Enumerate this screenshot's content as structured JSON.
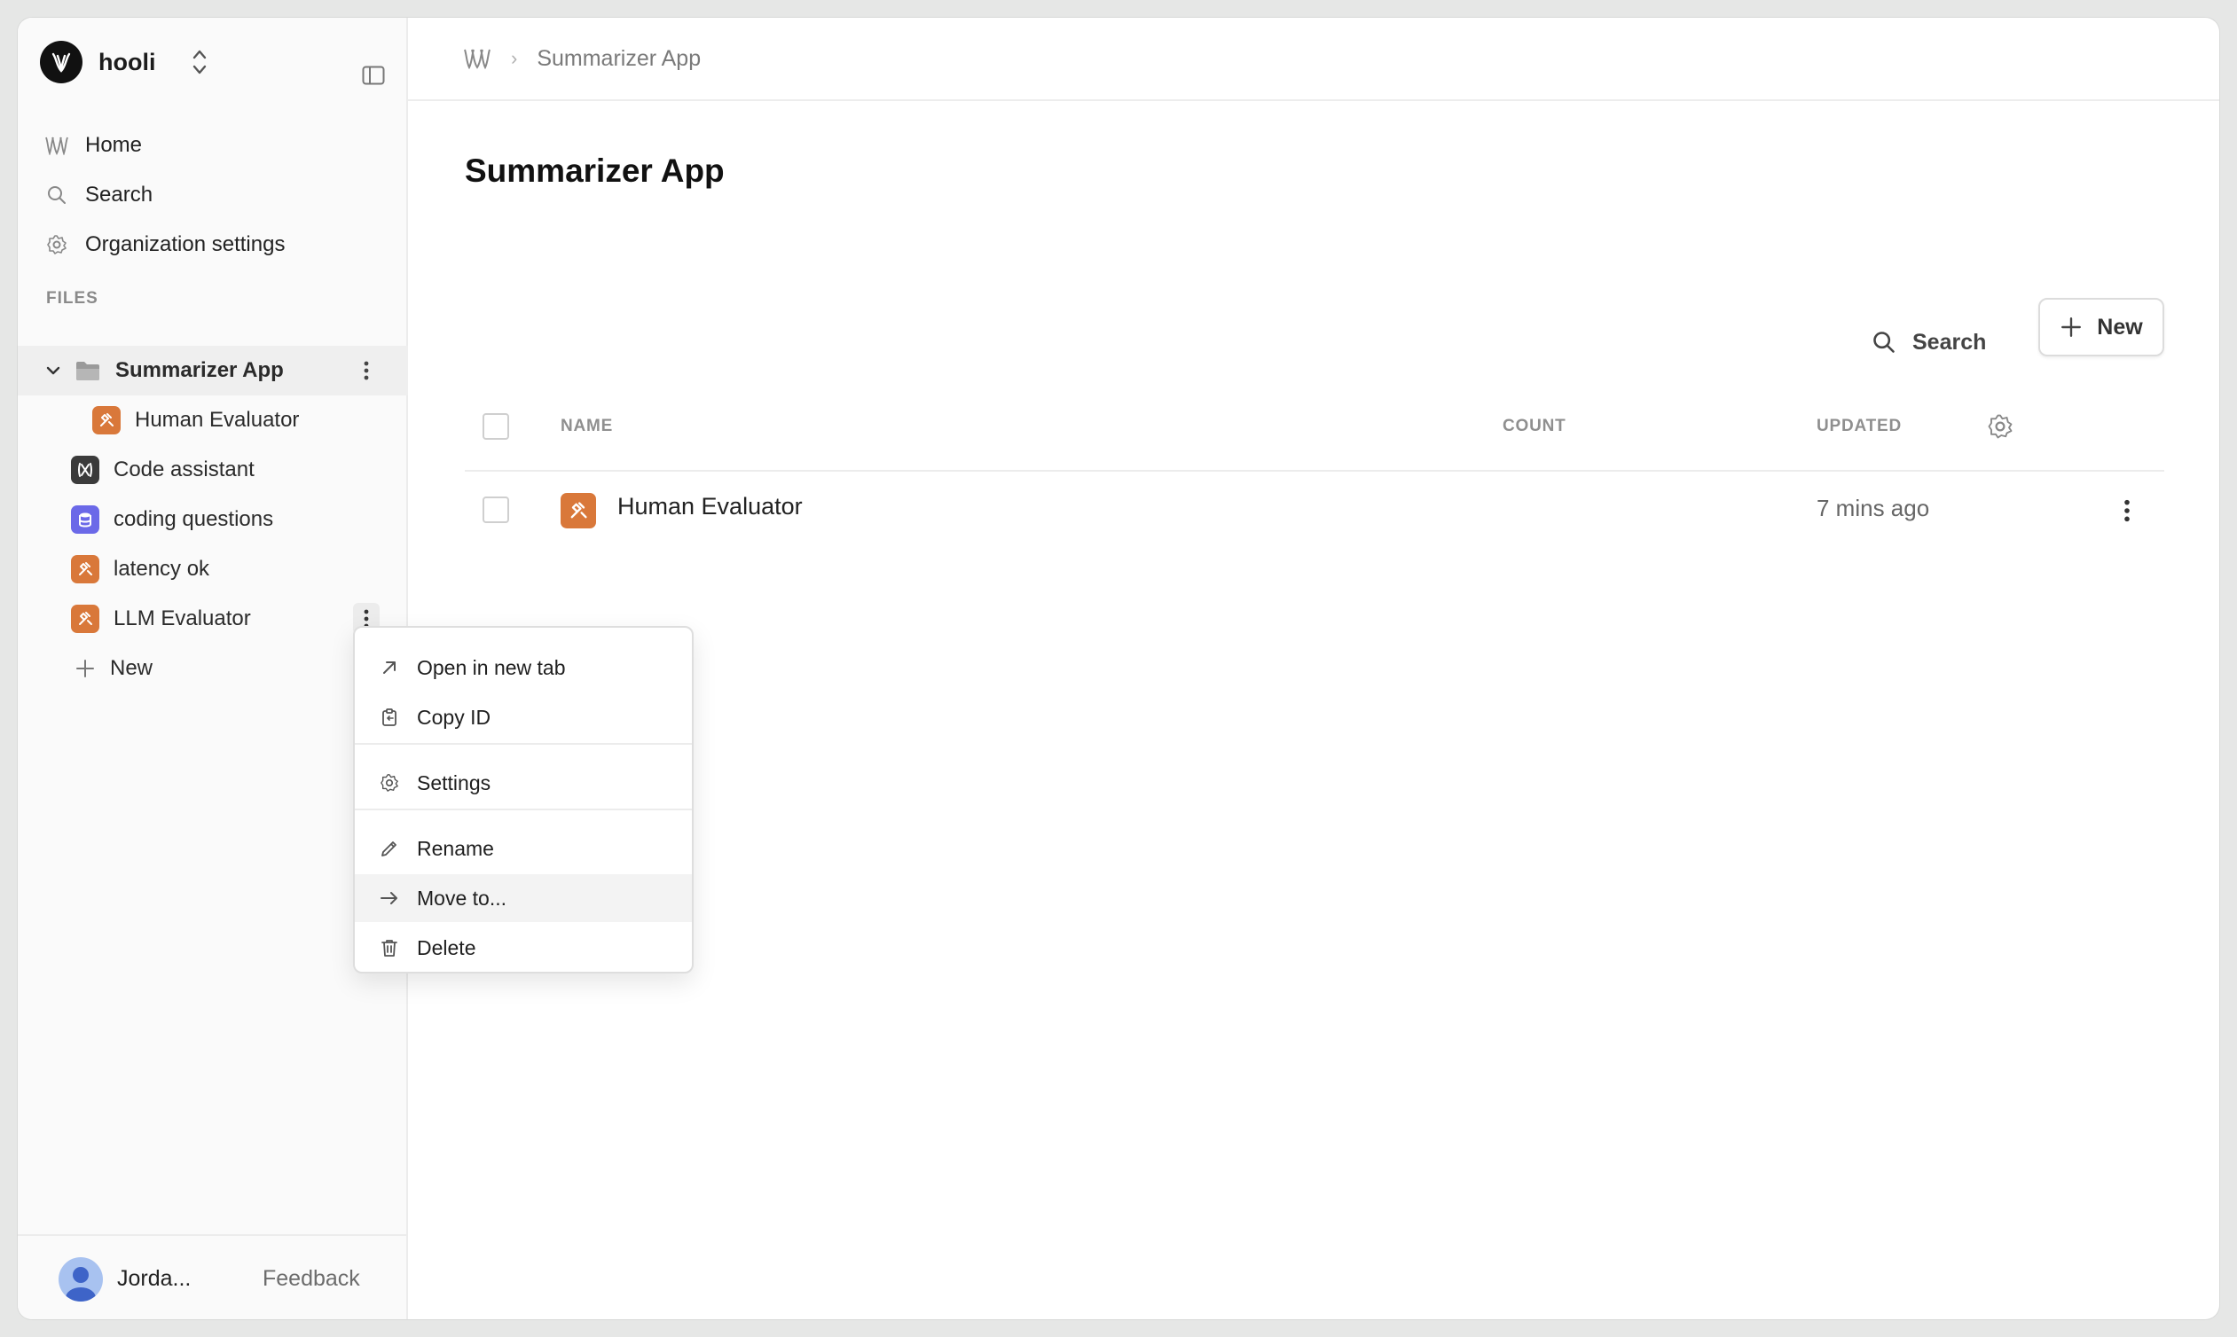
{
  "org": {
    "name": "hooli"
  },
  "nav": [
    {
      "label": "Home",
      "icon": "home-logo-icon"
    },
    {
      "label": "Search",
      "icon": "search-icon"
    },
    {
      "label": "Organization settings",
      "icon": "gear-icon"
    }
  ],
  "files": {
    "section_label": "FILES",
    "items": [
      {
        "label": "Summarizer App",
        "icon": "folder-icon"
      },
      {
        "label": "Human Evaluator",
        "icon": "evaluator-icon"
      },
      {
        "label": "Code assistant",
        "icon": "prompt-icon"
      },
      {
        "label": "coding questions",
        "icon": "dataset-icon"
      },
      {
        "label": "latency ok",
        "icon": "evaluator-icon"
      },
      {
        "label": "LLM Evaluator",
        "icon": "evaluator-icon"
      },
      {
        "label": "New",
        "icon": "plus-icon"
      }
    ]
  },
  "footer": {
    "user": "Jorda...",
    "feedback": "Feedback"
  },
  "breadcrumb": {
    "current": "Summarizer App"
  },
  "main": {
    "title": "Summarizer App",
    "search_label": "Search",
    "new_label": "New",
    "columns": {
      "name": "NAME",
      "count": "COUNT",
      "updated": "UPDATED"
    },
    "rows": [
      {
        "name": "Human Evaluator",
        "count": "",
        "updated": "7 mins ago"
      }
    ]
  },
  "context_menu": {
    "items": [
      {
        "label": "Open in new tab",
        "icon": "arrow-up-right-icon"
      },
      {
        "label": "Copy ID",
        "icon": "clipboard-icon"
      },
      {
        "label": "Settings",
        "icon": "gear-icon"
      },
      {
        "label": "Rename",
        "icon": "pencil-icon"
      },
      {
        "label": "Move to...",
        "icon": "arrow-right-icon"
      },
      {
        "label": "Delete",
        "icon": "trash-icon"
      }
    ],
    "highlighted": "Move to..."
  },
  "colors": {
    "evaluator": "#d9783a",
    "prompt": "#3b3b3b",
    "dataset": "#6b69e8",
    "selected_row": "#efefef"
  }
}
